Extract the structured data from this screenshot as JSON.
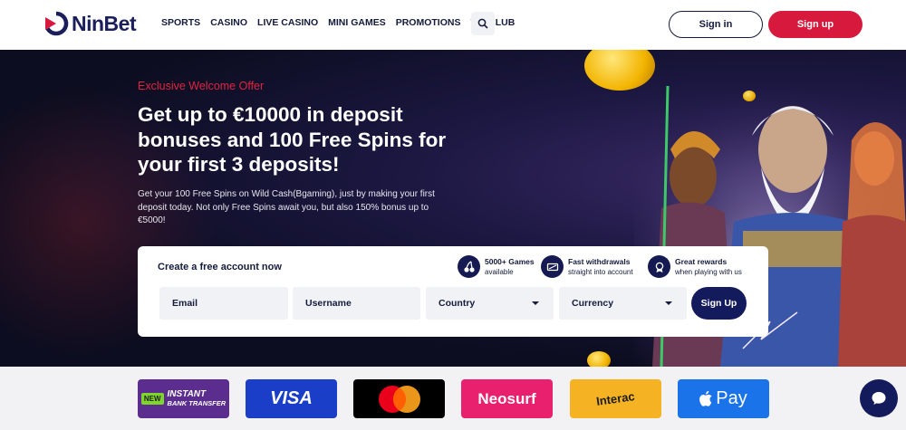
{
  "brand": {
    "name": "NinBet"
  },
  "nav": {
    "items": [
      "SPORTS",
      "CASINO",
      "LIVE CASINO",
      "MINI GAMES",
      "PROMOTIONS",
      "VIP CLUB"
    ]
  },
  "header": {
    "signin_label": "Sign in",
    "signup_label": "Sign up"
  },
  "hero": {
    "offer": "Exclusive Welcome Offer",
    "headline": "Get up to €10000 in deposit bonuses and 100 Free Spins for your first 3 deposits!",
    "description": "Get your 100 Free Spins on Wild Cash(Bgaming), just by making your first deposit today. Not only Free Spins await you, but also 150% bonus up to €5000!"
  },
  "form": {
    "title": "Create a free account now",
    "perks": [
      {
        "title": "5000+ Games",
        "subtitle": "available",
        "icon": "cherries-icon"
      },
      {
        "title": "Fast withdrawals",
        "subtitle": "straight into account",
        "icon": "ticket-icon"
      },
      {
        "title": "Great rewards",
        "subtitle": "when playing with us",
        "icon": "medal-icon"
      }
    ],
    "email_placeholder": "Email",
    "username_placeholder": "Username",
    "country_label": "Country",
    "currency_label": "Currency",
    "submit_label": "Sign Up"
  },
  "payments": {
    "instant": {
      "badge": "NEW",
      "line1": "INSTANT",
      "line2": "BANK TRANSFER"
    },
    "visa": "VISA",
    "neosurf": "Neosurf",
    "interac": "Interac",
    "applepay": "Pay"
  },
  "colors": {
    "brand_red": "#d7193e",
    "navy": "#141b5c"
  }
}
